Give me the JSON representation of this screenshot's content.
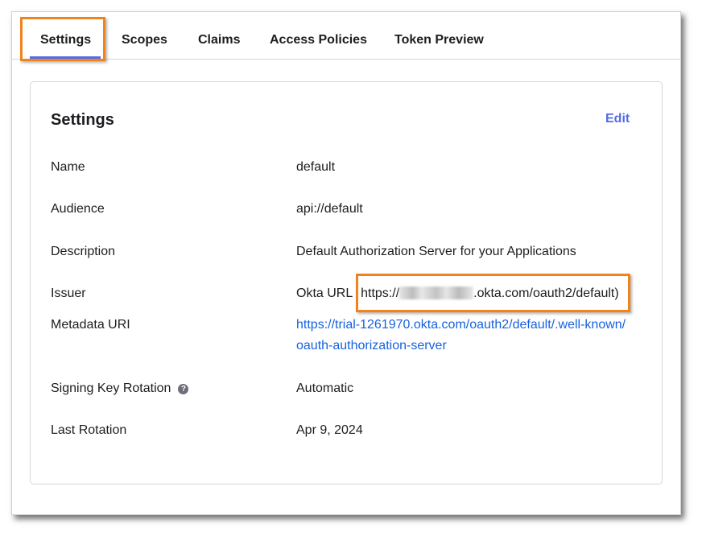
{
  "tabs": [
    {
      "label": "Settings",
      "active": true
    },
    {
      "label": "Scopes"
    },
    {
      "label": "Claims"
    },
    {
      "label": "Access Policies"
    },
    {
      "label": "Token Preview"
    }
  ],
  "card": {
    "title": "Settings",
    "edit_label": "Edit",
    "rows": {
      "name": {
        "label": "Name",
        "value": "default"
      },
      "audience": {
        "label": "Audience",
        "value": "api://default"
      },
      "description": {
        "label": "Description",
        "value": "Default Authorization Server for your Applications"
      },
      "issuer": {
        "label": "Issuer",
        "prefix": "Okta URL",
        "url_start": "https://",
        "url_end": ".okta.com/oauth2/default)"
      },
      "metadata": {
        "label": "Metadata URI",
        "line1": "https://trial-1261970.okta.com/oauth2/default/.well-known/",
        "line2": "oauth-authorization-server"
      },
      "signing": {
        "label": "Signing Key Rotation",
        "help_icon": "?",
        "value": "Automatic"
      },
      "last_rotation": {
        "label": "Last Rotation",
        "value": "Apr 9, 2024"
      }
    }
  },
  "colors": {
    "accent": "#546be7",
    "link": "#1662dd",
    "highlight": "#f0831c"
  }
}
